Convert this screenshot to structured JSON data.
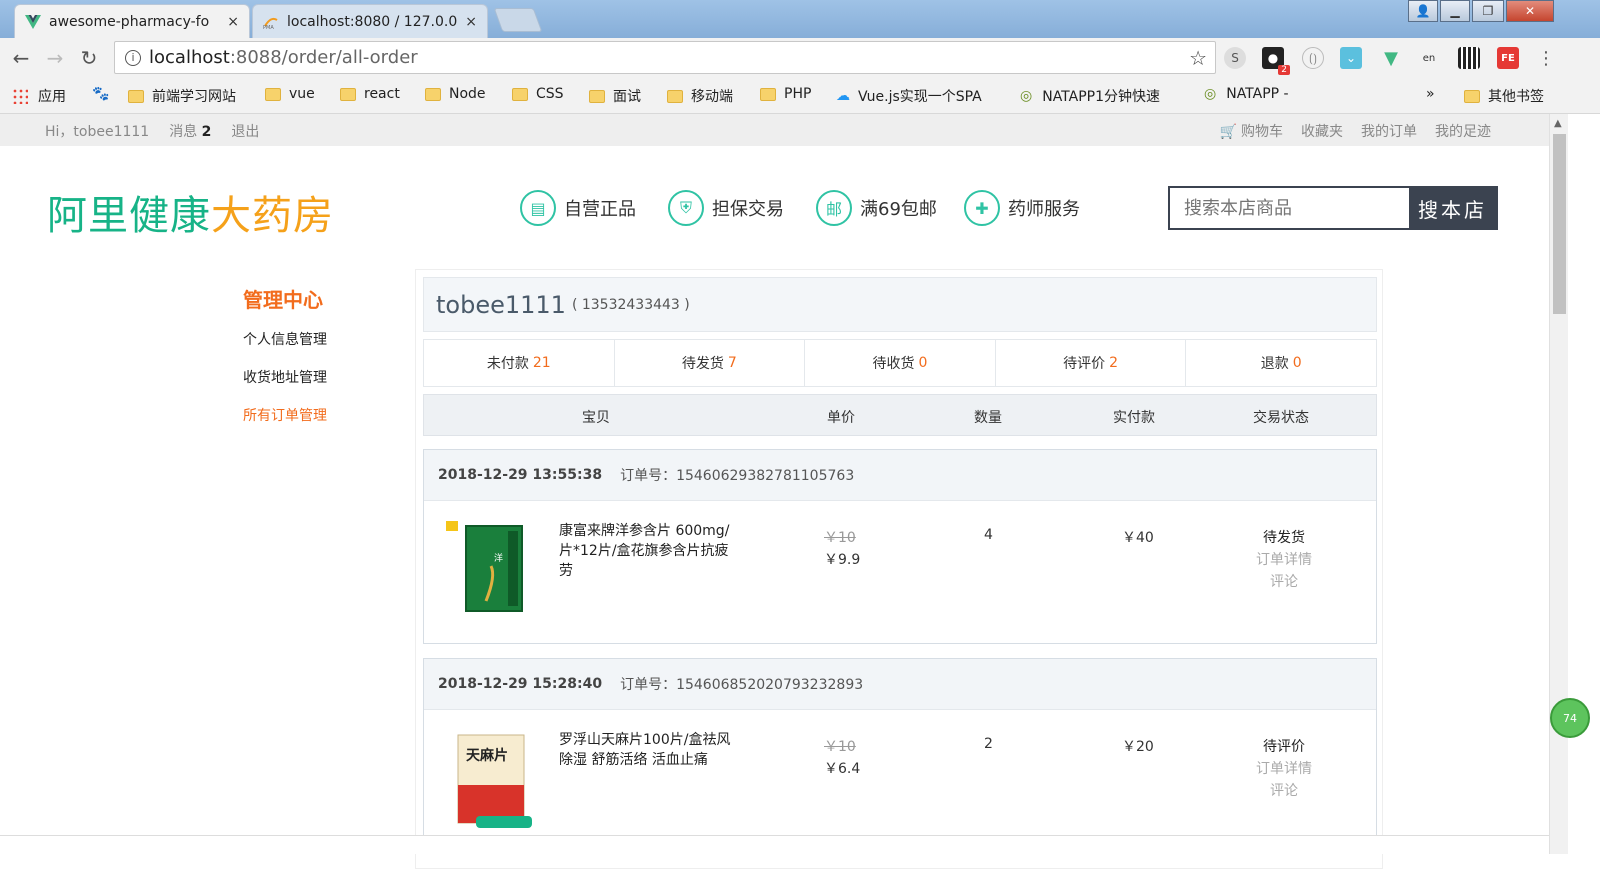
{
  "browser": {
    "tabs": [
      {
        "title": "awesome-pharmacy-fo",
        "close": "×"
      },
      {
        "title": "localhost:8080 / 127.0.0",
        "close": "×"
      }
    ],
    "url_host": "localhost",
    "url_path": ":8088/order/all-order",
    "ext_badge": "2",
    "bookmarks": [
      "应用",
      "前端学习网站",
      "vue",
      "react",
      "Node",
      "CSS",
      "面试",
      "移动端",
      "PHP",
      "Vue.js实现一个SPA",
      "NATAPP1分钟快速",
      "NATAPP -",
      "»",
      "其他书签"
    ]
  },
  "sitebar": {
    "greeting": "Hi，tobee1111",
    "messages_label": "消息",
    "messages_count": "2",
    "logout": "退出",
    "cart": "购物车",
    "favorites": "收藏夹",
    "my_orders": "我的订单",
    "footprints": "我的足迹"
  },
  "logo": {
    "green": "阿里健康",
    "orange": "大药房"
  },
  "services": [
    {
      "icon": "self-operated-icon",
      "label": "自营正品"
    },
    {
      "icon": "shield-icon",
      "label": "担保交易"
    },
    {
      "icon": "mail-icon",
      "label": "满69包邮"
    },
    {
      "icon": "pharmacist-icon",
      "label": "药师服务"
    }
  ],
  "search": {
    "placeholder": "搜索本店商品",
    "button": "搜本店"
  },
  "sidenav": {
    "title": "管理中心",
    "items": [
      "个人信息管理",
      "收货地址管理",
      "所有订单管理"
    ]
  },
  "user": {
    "name": "tobee1111",
    "phone": "( 13532433443 )"
  },
  "stats": [
    {
      "label": "未付款",
      "count": "21"
    },
    {
      "label": "待发货",
      "count": "7"
    },
    {
      "label": "待收货",
      "count": "0"
    },
    {
      "label": "待评价",
      "count": "2"
    },
    {
      "label": "退款",
      "count": "0"
    }
  ],
  "table_headers": [
    "宝贝",
    "单价",
    "数量",
    "实付款",
    "交易状态"
  ],
  "orders": [
    {
      "date": "2018-12-29 13:55:38",
      "order_no": "订单号：15460629382781105763",
      "product": "康富来牌洋参含片 600mg/片*12片/盒花旗参含片抗疲劳",
      "old_price": "￥10",
      "price": "￥9.9",
      "qty": "4",
      "paid": "￥40",
      "status": "待发货",
      "detail": "订单详情",
      "comment": "评论"
    },
    {
      "date": "2018-12-29 15:28:40",
      "order_no": "订单号：15460685202079323289​3",
      "product": "罗浮山天麻片100片/盒祛风除湿 舒筋活络 活血止痛",
      "old_price": "￥10",
      "price": "￥6.4",
      "qty": "2",
      "paid": "￥20",
      "status": "待评价",
      "detail": "订单详情",
      "comment": "评论"
    }
  ],
  "float_button": "74"
}
